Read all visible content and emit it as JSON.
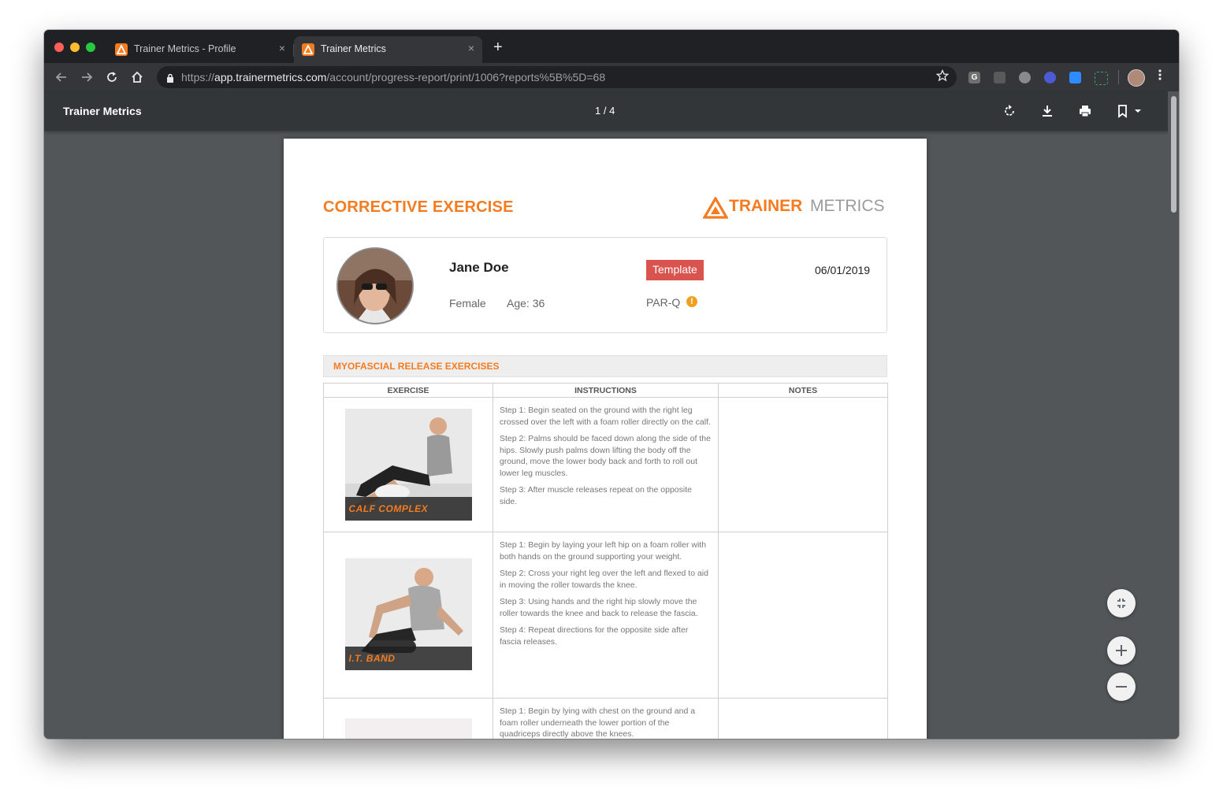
{
  "browser": {
    "tabs": [
      {
        "title": "Trainer Metrics - Profile",
        "active": false
      },
      {
        "title": "Trainer Metrics",
        "active": true
      }
    ],
    "close_glyph": "×",
    "new_tab_glyph": "+",
    "url_prefix": "https://",
    "url_domain": "app.trainermetrics.com",
    "url_path": "/account/progress-report/print/1006?reports%5B%5D=68",
    "ext_g_label": "G"
  },
  "pdf_viewer": {
    "title": "Trainer Metrics",
    "page_indicator": "1 / 4"
  },
  "document": {
    "heading": "CORRECTIVE EXERCISE",
    "logo_part1": "TRAINER",
    "logo_part2": "METRICS",
    "client": {
      "name": "Jane Doe",
      "gender": "Female",
      "age_text": "Age: 36",
      "badge": "Template",
      "parq": "PAR-Q",
      "parq_alert_glyph": "!",
      "date": "06/01/2019"
    },
    "section_title": "MYOFASCIAL RELEASE EXERCISES",
    "columns": [
      "EXERCISE",
      "INSTRUCTIONS",
      "NOTES"
    ],
    "exercises": [
      {
        "label": "CALF COMPLEX",
        "steps": [
          "Step 1: Begin seated on the ground with the right leg crossed over the left with a foam roller directly on the calf.",
          "Step 2: Palms should be faced down along the side of the hips. Slowly push palms down lifting the body off the ground, move the lower body back and forth to roll out lower leg muscles.",
          "Step 3: After muscle releases repeat on the opposite side."
        ],
        "notes": ""
      },
      {
        "label": "I.T. BAND",
        "steps": [
          "Step 1: Begin by laying your left hip on a foam roller with both hands on the ground supporting your weight.",
          "Step 2: Cross your right leg over the left and flexed to aid in moving the roller towards the knee.",
          "Step 3: Using hands and the right hip slowly move the roller towards the knee and back to release the fascia.",
          "Step 4: Repeat directions for the opposite side after fascia releases."
        ],
        "notes": ""
      },
      {
        "label": "",
        "steps": [
          "Step 1: Begin by lying with chest on the ground and a foam roller underneath the lower portion of the quadriceps directly above the knees."
        ],
        "notes": ""
      }
    ]
  },
  "colors": {
    "accent": "#f47b20",
    "badge": "#d9534f",
    "viewer_bg": "#525659",
    "pdf_toolbar": "#323639"
  },
  "icons": {
    "rotate": "rotate-icon",
    "download": "download-icon",
    "print": "print-icon",
    "bookmark": "bookmark-icon",
    "fit": "fit-to-page-icon",
    "zoom_in": "zoom-in-icon",
    "zoom_out": "zoom-out-icon"
  }
}
